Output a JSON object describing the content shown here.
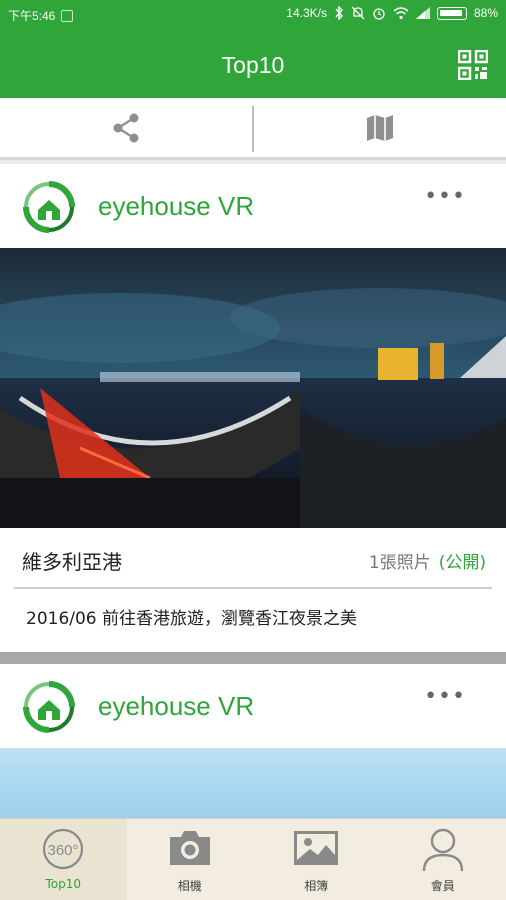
{
  "status": {
    "time": "下午5:46",
    "network": "14.3K/s",
    "battery": "88%"
  },
  "app_bar": {
    "title": "Top10"
  },
  "actions": {
    "share": "share-icon",
    "map": "map-icon"
  },
  "posts": [
    {
      "user": "eyehouse VR",
      "title": "維多利亞港",
      "photo_count": "1張照片",
      "visibility": "(公開)",
      "description": "2016/06 前往香港旅遊，瀏覽香江夜景之美"
    },
    {
      "user": "eyehouse VR"
    }
  ],
  "bottom_nav": [
    {
      "label": "Top10",
      "icon": "360-icon",
      "active": true
    },
    {
      "label": "相機",
      "icon": "camera-icon",
      "active": false
    },
    {
      "label": "相簿",
      "icon": "image-icon",
      "active": false
    },
    {
      "label": "會員",
      "icon": "person-icon",
      "active": false
    }
  ],
  "colors": {
    "primary": "#2fa53a",
    "nav_bg": "#f2ede0"
  }
}
